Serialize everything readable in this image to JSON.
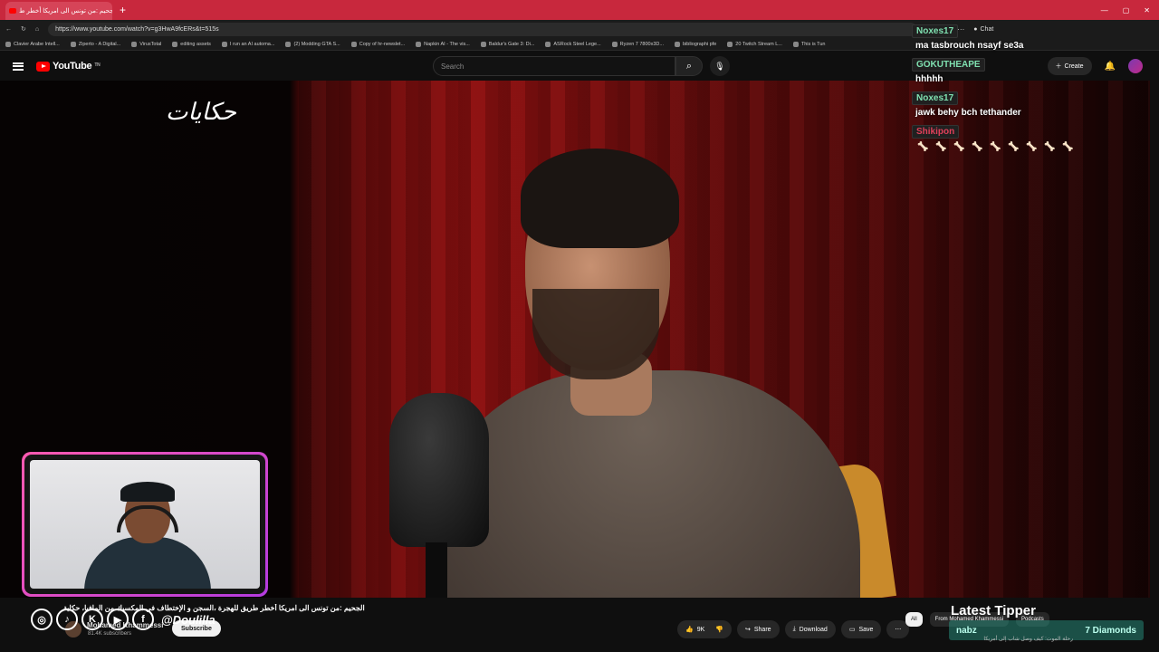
{
  "browser": {
    "tab_title": "الجحيم :من تونس الى امريكا أخطر ط",
    "url": "https://www.youtube.com/watch?v=g3HwA9fcERs&t=515s",
    "chat_label": "Chat",
    "bookmarks": [
      "Clavier Arabe Intell...",
      "Ziperto - A Digital...",
      "VirusTotal",
      "editing assets",
      "I run an AI automa...",
      "(2) Modding GTA S...",
      "Copy of hr-newslet...",
      "Napkin AI - The vis...",
      "Baldur's Gate 3: Di...",
      "ASRock Steel Lege...",
      "Ryzen 7 7800x3D...",
      "bibliographi pfe",
      "20 Twitch Stream L...",
      "This is Tun"
    ]
  },
  "youtube": {
    "logo_text": "YouTube",
    "logo_sup": "TN",
    "search_placeholder": "Search",
    "create_label": "Create"
  },
  "video": {
    "channel_watermark": "حكايات"
  },
  "chat": {
    "messages": [
      {
        "user": "Noxes17",
        "text": "ma tasbrouch nsayf se3a",
        "color": "#7fe0b0"
      },
      {
        "user": "GOKUTHEAPE",
        "text": "hhhhh",
        "color": "#7fe0b0"
      },
      {
        "user": "Noxes17",
        "text": "jawk behy bch tethander",
        "color": "#7fe0b0"
      },
      {
        "user": "Shikipon",
        "text": "",
        "color": "#e0405a"
      }
    ]
  },
  "below": {
    "title": "الجحيم :من تونس الى امريكا أخطر طريق للهجرة ،السجن و الإختطاف في المكسيك من المافيا، حكاية",
    "channel_name": "Mohamed Khammessi",
    "subscribers": "81.4K subscribers",
    "subscribe_label": "Subscribe",
    "handle": "@Doulilla",
    "likes": "9K",
    "share_label": "Share",
    "download_label": "Download",
    "save_label": "Save",
    "chips": [
      "All",
      "From Mohamed Khammessi",
      "Podcasts"
    ],
    "tipper_title": "Latest Tipper",
    "tipper_name": "nabz",
    "tipper_amount": "7 Diamonds",
    "next_video_title": "رحلة الموت: كيف وصل شاب إلى أمريكا"
  }
}
